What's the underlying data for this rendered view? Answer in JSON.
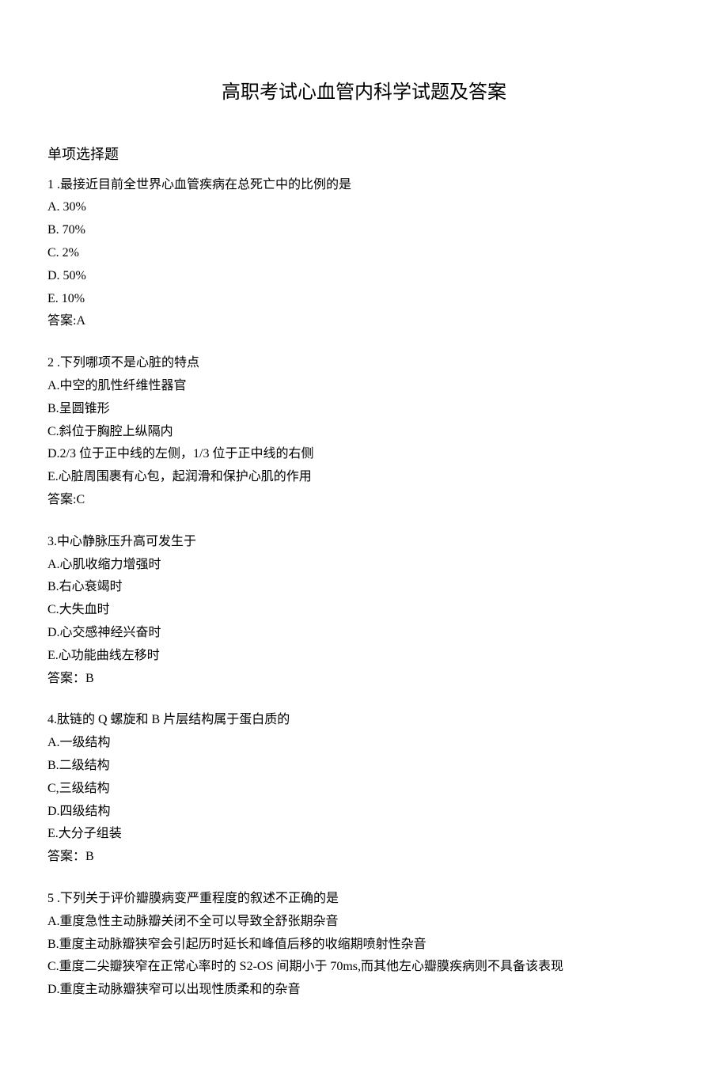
{
  "title": "高职考试心血管内科学试题及答案",
  "sectionHeading": "单项选择题",
  "questions": [
    {
      "num": "1 .最接近目前全世界心血管疾病在总死亡中的比例的是",
      "options": [
        "A.   30%",
        "B.   70%",
        "C.   2%",
        "D.   50%",
        "E.   10%"
      ],
      "answer": "答案:A"
    },
    {
      "num": "2 .下列哪项不是心脏的特点",
      "options": [
        "A.中空的肌性纤维性器官",
        "B.呈圆锥形",
        "C.斜位于胸腔上纵隔内",
        "D.2/3 位于正中线的左侧，1/3 位于正中线的右侧",
        "E.心脏周围裹有心包，起润滑和保护心肌的作用"
      ],
      "answer": "答案:C"
    },
    {
      "num": "3.中心静脉压升高可发生于",
      "options": [
        "A.心肌收缩力增强时",
        "B.右心衰竭时",
        "C.大失血时",
        "D.心交感神经兴奋时",
        "E.心功能曲线左移时"
      ],
      "answer": "答案：B"
    },
    {
      "num": "4.肽链的 Q 螺旋和 B 片层结构属于蛋白质的",
      "options": [
        "A.一级结构",
        "B.二级结构",
        "C,三级结构",
        "D.四级结构",
        "E.大分子组装"
      ],
      "answer": "答案：B"
    },
    {
      "num": "5 .下列关于评价瓣膜病变严重程度的叙述不正确的是",
      "options": [
        "A.重度急性主动脉瓣关闭不全可以导致全舒张期杂音",
        "B.重度主动脉瓣狭窄会引起历时延长和峰值后移的收缩期喷射性杂音",
        "C.重度二尖瓣狭窄在正常心率时的 S2-OS 间期小于 70ms,而其他左心瓣膜疾病则不具备该表现",
        "D.重度主动脉瓣狭窄可以出现性质柔和的杂音"
      ],
      "answer": ""
    }
  ]
}
